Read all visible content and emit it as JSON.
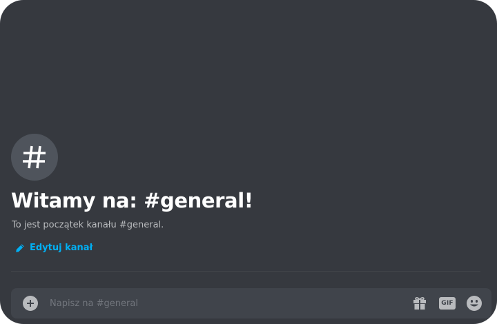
{
  "welcome": {
    "title": "Witamy na: #general!",
    "subtitle": "To jest początek kanału #general.",
    "edit_label": "Edytuj kanał"
  },
  "composer": {
    "placeholder": "Napisz na #general",
    "gif_label": "GIF"
  },
  "icons": {
    "channel": "hashtag-icon",
    "edit": "pencil-icon",
    "attach": "plus-circle-icon",
    "gift": "gift-icon",
    "gif": "gif-icon",
    "emoji": "smiley-icon"
  },
  "colors": {
    "background": "#36393f",
    "composer": "#40444b",
    "link": "#00b0f4",
    "title": "#ffffff",
    "muted": "#b9bbbe",
    "placeholder": "#72767d"
  }
}
